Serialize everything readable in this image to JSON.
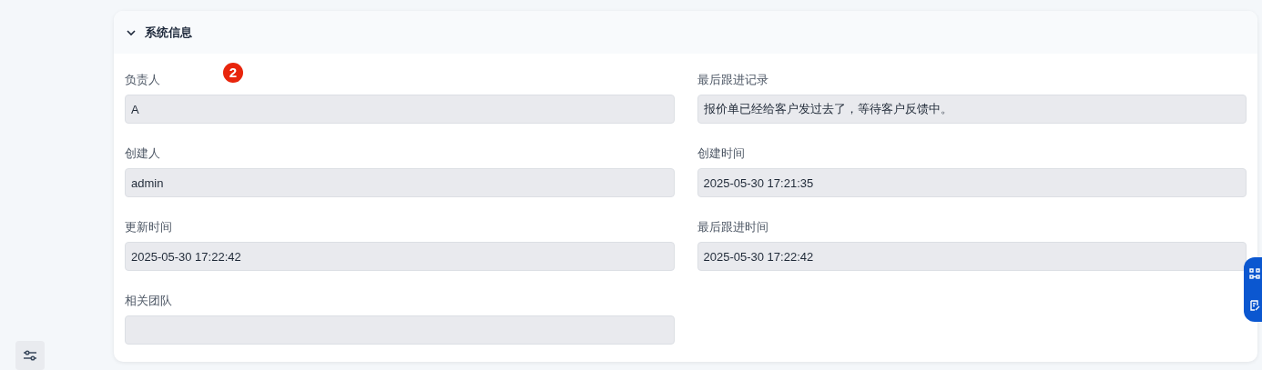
{
  "section": {
    "title": "系统信息",
    "expanded": true
  },
  "marker": "2",
  "fields": [
    {
      "label": "负责人",
      "value": "A",
      "disabled": true
    },
    {
      "label": "最后跟进记录",
      "value": "报价单已经给客户发过去了，等待客户反馈中。",
      "disabled": true
    },
    {
      "label": "创建人",
      "value": "admin",
      "disabled": true
    },
    {
      "label": "创建时间",
      "value": "2025-05-30 17:21:35",
      "disabled": true
    },
    {
      "label": "更新时间",
      "value": "2025-05-30 17:22:42",
      "disabled": true
    },
    {
      "label": "最后跟进时间",
      "value": "2025-05-30 17:22:42",
      "disabled": true
    },
    {
      "label": "相关团队",
      "disabled": true
    }
  ]
}
